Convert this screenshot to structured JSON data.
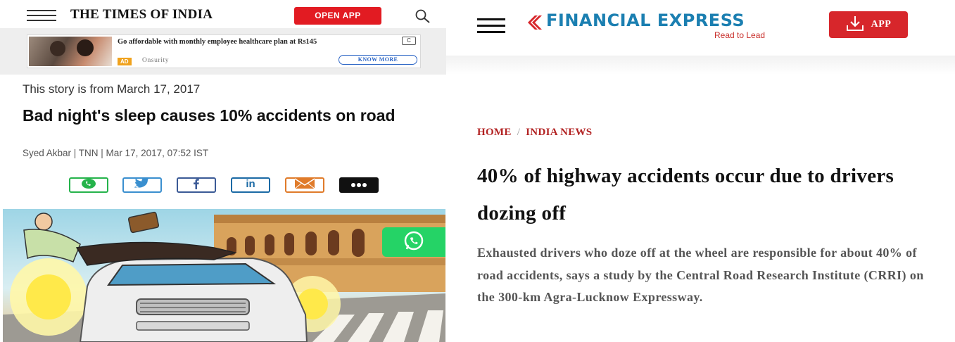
{
  "toi": {
    "logo": "THE TIMES OF INDIA",
    "open_app": "OPEN APP",
    "ad": {
      "text": "Go affordable with monthly employee healthcare plan at Rs145",
      "tag": "AD",
      "brand": "Onsurity",
      "cta": "KNOW MORE",
      "choice": "C"
    },
    "dateline": "This story is from March 17, 2017",
    "headline": "Bad night's sleep causes 10% accidents on road",
    "byline": "Syed Akbar | TNN | Mar 17, 2017, 07:52 IST",
    "share_icons": [
      "whatsapp-icon",
      "twitter-icon",
      "facebook-icon",
      "linkedin-icon",
      "email-icon",
      "more-icon"
    ],
    "colors": {
      "brand_red": "#e21b22",
      "whatsapp_green": "#25d366"
    }
  },
  "fe": {
    "logo": "FINANCIAL EXPRESS",
    "tagline": "Read to Lead",
    "app_button": "APP",
    "breadcrumb": {
      "home": "HOME",
      "separator": "/",
      "section": "INDIA NEWS"
    },
    "headline": "40% of highway accidents occur due to drivers dozing off",
    "summary": "Exhausted drivers who doze off at the wheel are responsible for about 40% of road accidents, says a study by the Central Road Research Institute (CRRI) on the 300-km Agra-Lucknow Expressway.",
    "colors": {
      "brand_blue": "#1b7fb1",
      "accent_red": "#d7262b"
    }
  }
}
